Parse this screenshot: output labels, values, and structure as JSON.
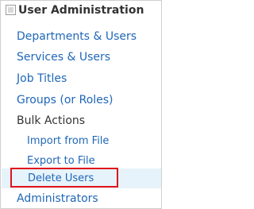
{
  "header": {
    "title": "User Administration",
    "icon": "checkbox-square-icon"
  },
  "nav": {
    "items": [
      {
        "label": "Departments & Users"
      },
      {
        "label": "Services & Users"
      },
      {
        "label": "Job Titles"
      },
      {
        "label": "Groups (or Roles)"
      }
    ],
    "bulk_actions": {
      "label": "Bulk Actions",
      "children": [
        {
          "label": "Import from File"
        },
        {
          "label": "Export to File"
        },
        {
          "label": "Delete Users"
        }
      ]
    },
    "administrators": {
      "label": "Administrators"
    }
  },
  "colors": {
    "link": "#1f67b8",
    "text": "#333333",
    "highlight_border": "#e0131d",
    "active_row": "#e7f3fa"
  }
}
